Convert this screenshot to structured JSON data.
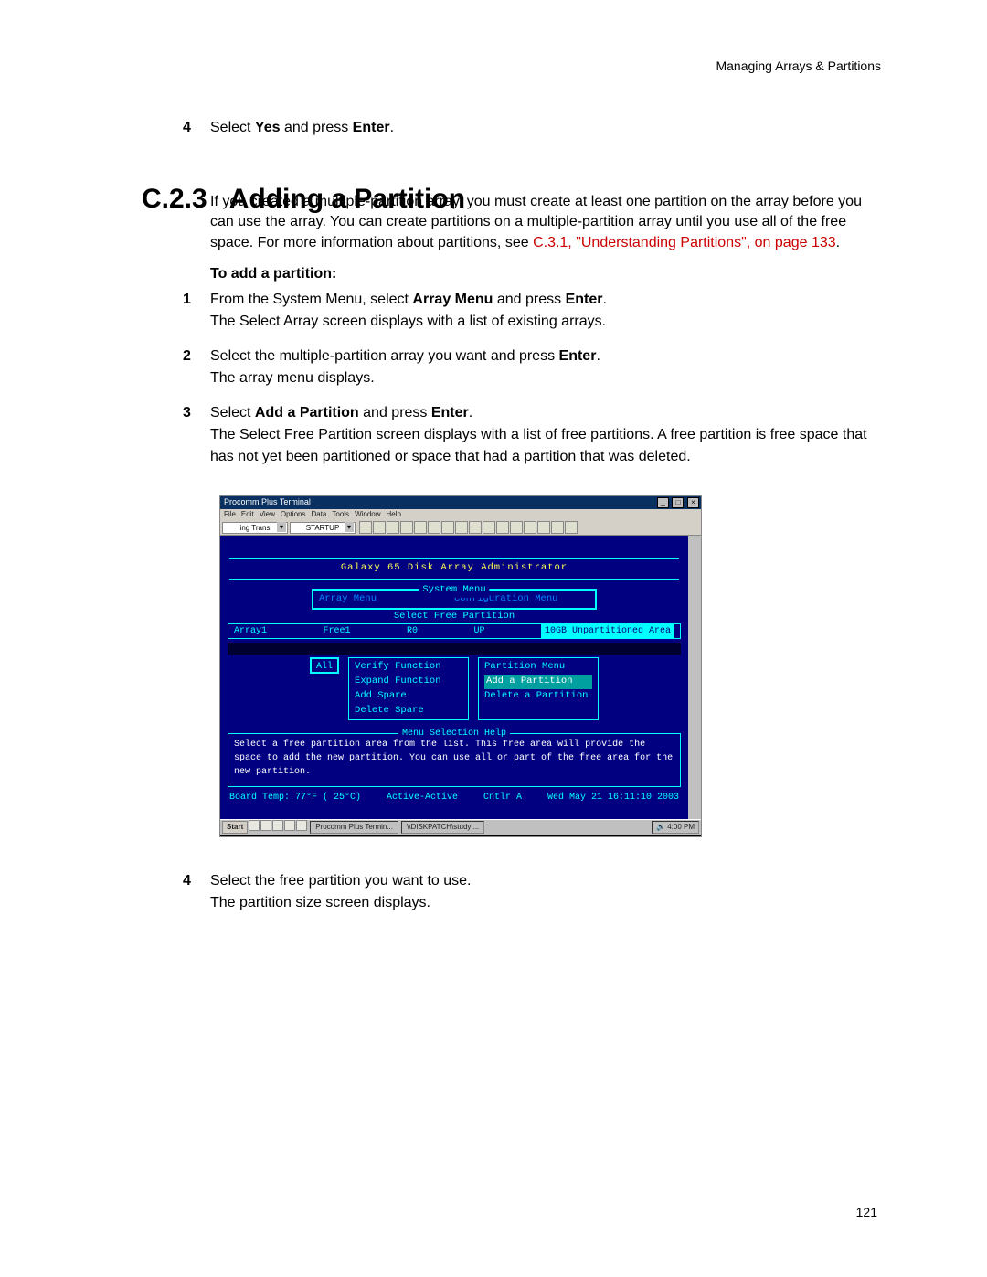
{
  "header": "Managing Arrays & Partitions",
  "step4_pre": {
    "num": "4",
    "text_a": "Select ",
    "yes": "Yes",
    "text_b": " and press ",
    "enter": "Enter",
    "text_c": "."
  },
  "section": {
    "num": "C.2.3",
    "title": "Adding a Partition"
  },
  "intro": {
    "p1": "If you created a multiple-partition array, you must create at least one partition on the array before you can use the array. You can create partitions on a multiple-partition array until you use all of the free space. For more information about partitions, see ",
    "xref": "C.3.1, \"Understanding Partitions\", on page 133",
    "tail": "."
  },
  "subhead": "To add a partition:",
  "steps": {
    "s1": {
      "num": "1",
      "a": "From the System Menu, select ",
      "b1": "Array Menu",
      "c": " and press ",
      "b2": "Enter",
      "d": ".",
      "sub": "The Select Array screen displays with a list of existing arrays."
    },
    "s2": {
      "num": "2",
      "a": "Select the multiple-partition array you want and press ",
      "b1": "Enter",
      "c": ".",
      "sub": "The array menu displays."
    },
    "s3": {
      "num": "3",
      "a": "Select ",
      "b1": "Add a Partition",
      "c": " and press ",
      "b2": "Enter",
      "d": ".",
      "sub": "The Select Free Partition screen displays with a list of free partitions. A free partition is free space that has not yet been partitioned or space that had a partition that was deleted."
    },
    "s4": {
      "num": "4",
      "a": "Select the free partition you want to use.",
      "sub": "The partition size screen displays."
    }
  },
  "win": {
    "title": "Procomm Plus Terminal",
    "menu": [
      "File",
      "Edit",
      "View",
      "Options",
      "Data",
      "Tools",
      "Window",
      "Help"
    ],
    "dd1": "ing Trans",
    "dd2": "STARTUP"
  },
  "term": {
    "title": "Galaxy 65 Disk Array Administrator",
    "system_menu_label": "System Menu",
    "array_menu": "Array Menu",
    "config_menu": "Configuration Menu",
    "select_free_label": "Select Free Partition",
    "row": {
      "c1": "Array1",
      "c2": "Free1",
      "c3": "R0",
      "c4": "UP",
      "c5": "10GB Unpartitioned Area"
    },
    "all": "All",
    "menu_left": [
      "Verify Function",
      "Expand Function",
      "Add Spare",
      "Delete Spare"
    ],
    "menu_right_title": "Partition Menu",
    "menu_right": [
      "Add a Partition",
      "Delete a Partition"
    ],
    "help_label": "Menu Selection Help",
    "help_text": "Select a free partition area from the list.  This free area will provide the space to add the new partition.  You can use all or part of the free area for the new partition.",
    "status": {
      "temp": "Board Temp:  77°F ( 25°C)",
      "mode": "Active-Active",
      "ctrl": "Cntlr A",
      "time": "Wed May 21 16:11:10 2003"
    }
  },
  "taskbar": {
    "start": "Start",
    "task1": "Procomm Plus Termin...",
    "task2": "\\\\DISKPATCH\\study ...",
    "clock": "4:00 PM"
  },
  "page_number": "121"
}
